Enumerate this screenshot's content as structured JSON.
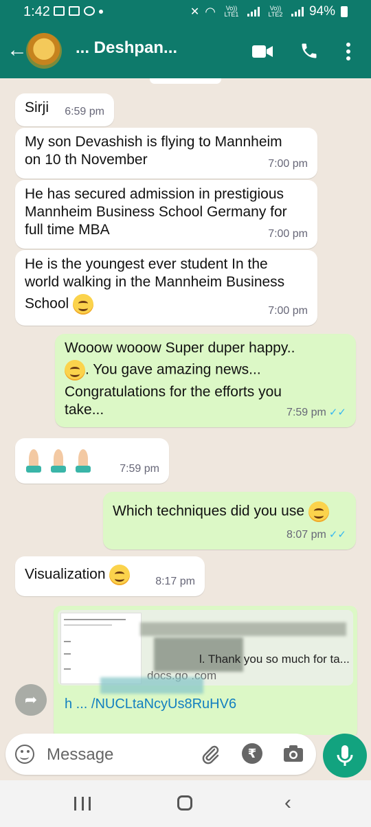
{
  "status_bar": {
    "time": "1:42",
    "battery": "94%",
    "sim1": "Vo)) LTE1",
    "sim2": "Vo)) LTE2"
  },
  "header": {
    "contact_name": "... Deshpan...",
    "icons": [
      "back-arrow-icon",
      "video-call-icon",
      "voice-call-icon",
      "more-options-icon"
    ],
    "background_color": "#0e7a6b"
  },
  "messages": [
    {
      "direction": "in",
      "text": "Sirji",
      "time": "6:59 pm"
    },
    {
      "direction": "in",
      "text_lines": [
        "My son Devashish is flying to Mannheim",
        "on 10 th November"
      ],
      "time": "7:00 pm"
    },
    {
      "direction": "in",
      "text_lines": [
        "He has secured admission in prestigious",
        "Mannheim Business School Germany for",
        "full time MBA"
      ],
      "time": "7:00 pm"
    },
    {
      "direction": "in",
      "text_lines": [
        "He is the youngest ever student In the",
        "world walking in the Mannheim Business",
        "School"
      ],
      "time": "7:00 pm"
    },
    {
      "direction": "out",
      "text_lines": [
        "Wooow wooow  Super duper happy..",
        ". You gave amazing news...",
        "Congratulations for the efforts you",
        "take..."
      ],
      "time": "7:59 pm",
      "status": "read"
    },
    {
      "direction": "in",
      "emojis": [
        "folded-hands",
        "folded-hands",
        "folded-hands"
      ],
      "time": "7:59 pm"
    },
    {
      "direction": "out",
      "text": "Which techniques did you use",
      "time": "8:07 pm",
      "status": "read"
    },
    {
      "direction": "in",
      "text": "Visualization",
      "time": "8:17 pm"
    }
  ],
  "link_preview": {
    "title": "l. Thank you so much for ta...",
    "domain": "docs.go      .com",
    "url_visible": "h      ...  /NUCLtaNcyUs8RuHV6"
  },
  "composer": {
    "placeholder": "Message",
    "icons": [
      "emoji-icon",
      "attach-icon",
      "rupee-payment-icon",
      "camera-icon",
      "mic-icon"
    ]
  },
  "accent_colors": {
    "outgoing_bubble": "#dcf8c6",
    "incoming_bubble": "#ffffff",
    "mic_button": "#12a37f",
    "read_ticks": "#34b7f1"
  }
}
